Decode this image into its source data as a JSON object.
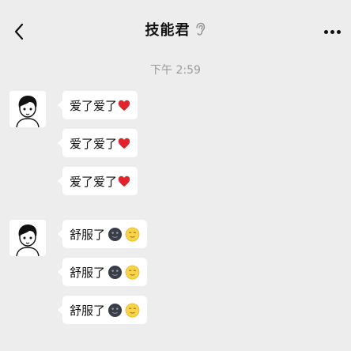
{
  "header": {
    "title": "技能君",
    "back_icon": "chevron-left-icon",
    "status_icon": "ear-icon",
    "more_icon": "more-dots-icon"
  },
  "timestamp": "下午 2:59",
  "groups": [
    {
      "avatar": "cartoon-boy-avatar",
      "messages": [
        {
          "text": "爱了爱了",
          "emoji": [
            "red-heart"
          ]
        },
        {
          "text": "爱了爱了",
          "emoji": [
            "red-heart"
          ]
        },
        {
          "text": "爱了爱了",
          "emoji": [
            "red-heart"
          ]
        }
      ]
    },
    {
      "avatar": "cartoon-boy-avatar",
      "messages": [
        {
          "text": "舒服了",
          "emoji": [
            "dark-face",
            "yellow-face"
          ]
        },
        {
          "text": "舒服了",
          "emoji": [
            "dark-face",
            "yellow-face"
          ]
        },
        {
          "text": "舒服了",
          "emoji": [
            "dark-face",
            "yellow-face"
          ]
        }
      ]
    }
  ],
  "colors": {
    "background": "#ededed",
    "bubble": "#ffffff",
    "heart": "#e0242b",
    "timestamp": "#9a9a9a"
  }
}
